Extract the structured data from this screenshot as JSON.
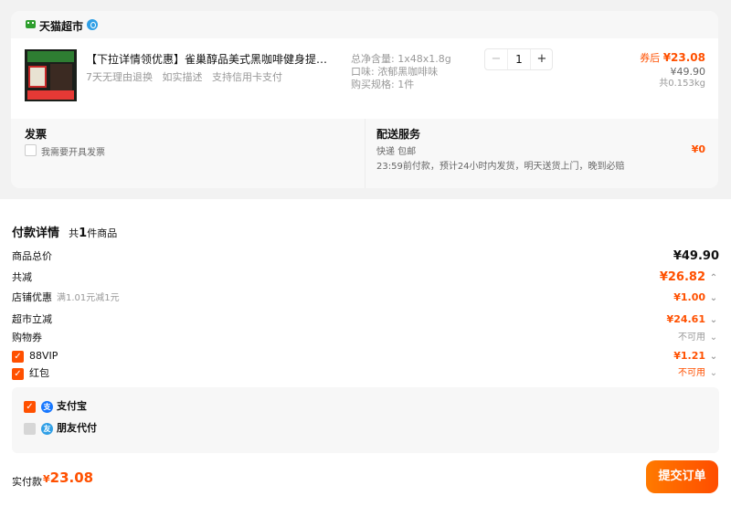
{
  "colors": {
    "accent": "#ff5000",
    "store_logo": "#2e9f2e",
    "alipay_blue": "#1677ff",
    "friend_pay_blue": "#2f9fe6"
  },
  "store": {
    "name": "天猫超市",
    "logo_icon": "tmall-logo-icon",
    "badge_icon": "verified-badge-icon"
  },
  "product": {
    "title": "【下拉详情领优惠】雀巢醇品美式黑咖啡健身提神即溶...",
    "tags": [
      "7天无理由退换",
      "如实描述",
      "支持信用卡支付"
    ],
    "specs": [
      "总净含量: 1x48x1.8g",
      "口味: 浓郁黑咖啡味",
      "购买规格: 1件"
    ],
    "quantity": "1",
    "minus": "−",
    "plus": "+",
    "price_label": "券后",
    "price_current": "¥23.08",
    "price_original": "¥49.90",
    "weight": "共0.153kg"
  },
  "invoice": {
    "title": "发票",
    "checkbox_label": "我需要开具发票"
  },
  "delivery": {
    "title": "配送服务",
    "line1": "快递 包邮",
    "line2": "23:59前付款，预计24小时内发货，明天送货上门，晚到必赔",
    "price": "¥0"
  },
  "payment": {
    "title": "付款详情",
    "count_prefix": "共",
    "count": "1",
    "count_suffix": "件商品",
    "rows": [
      {
        "label": "商品总价",
        "value": "¥49.90"
      },
      {
        "label": "共减",
        "value": "¥26.82",
        "chevron": "⌃"
      },
      {
        "label": "店铺优惠",
        "note": "满1.01元减1元",
        "value": "¥1.00",
        "chevron": "⌄"
      },
      {
        "label": "超市立减",
        "value": "¥24.61",
        "chevron": "⌄"
      },
      {
        "label": "购物券",
        "value": "不可用",
        "chevron": "⌄"
      },
      {
        "label": "88VIP",
        "value": "¥1.21",
        "chevron": "⌄",
        "checked": true
      },
      {
        "label": "红包",
        "value": "不可用",
        "chevron": "⌄",
        "checked": true
      }
    ],
    "methods": [
      {
        "label": "支付宝",
        "checked": true,
        "icon": "alipay-icon"
      },
      {
        "label": "朋友代付",
        "checked": false,
        "icon": "friend-pay-icon"
      }
    ]
  },
  "footer": {
    "total_label": "实付款",
    "total_currency": "¥",
    "total_value": "23.08",
    "submit_label": "提交订单"
  }
}
